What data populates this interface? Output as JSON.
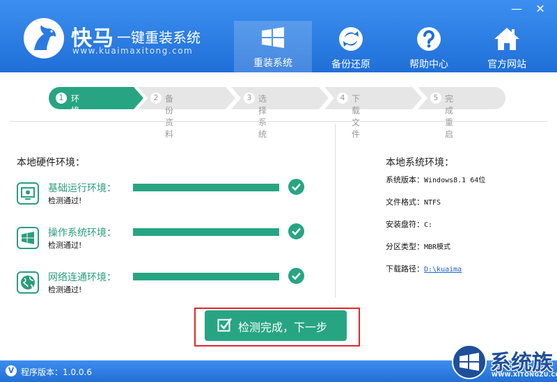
{
  "window": {
    "minimize_glyph": "—",
    "close_glyph": "✕"
  },
  "brand": {
    "name": "快马",
    "subtitle": "一键重装系统",
    "url": "www.kuaimaxitong.com"
  },
  "nav": [
    {
      "label": "重装系统",
      "icon": "windows-icon",
      "active": true
    },
    {
      "label": "备份还原",
      "icon": "sync-icon",
      "active": false
    },
    {
      "label": "帮助中心",
      "icon": "help-icon",
      "active": false
    },
    {
      "label": "官方网站",
      "icon": "home-icon",
      "active": false
    }
  ],
  "steps": [
    {
      "num": "1",
      "label": "环境检测",
      "active": true
    },
    {
      "num": "2",
      "label": "备份资料",
      "active": false
    },
    {
      "num": "3",
      "label": "选择系统",
      "active": false
    },
    {
      "num": "4",
      "label": "下载文件",
      "active": false
    },
    {
      "num": "5",
      "label": "完成重启",
      "active": false
    }
  ],
  "hardware": {
    "title": "本地硬件环境：",
    "rows": [
      {
        "label": "基础运行环境：",
        "status": "检测通过!",
        "icon": "monitor-icon",
        "progress": 1.0
      },
      {
        "label": "操作系统环境：",
        "status": "检测通过!",
        "icon": "windows-icon",
        "progress": 1.0
      },
      {
        "label": "网络连通环境：",
        "status": "检测通过!",
        "icon": "globe-icon",
        "progress": 1.0
      }
    ]
  },
  "system": {
    "title": "本地系统环境：",
    "version_label": "系统版本：",
    "version_value": "Windows8.1  64位",
    "fs_label": "文件格式：",
    "fs_value": "NTFS",
    "drive_label": "安装盘符：",
    "drive_value": "C:",
    "partition_label": "分区类型：",
    "partition_value": "MBR模式",
    "download_label": "下载路径：",
    "download_value": "D:\\kuaima"
  },
  "next_button": {
    "label": "检测完成，下一步"
  },
  "footer": {
    "badge": "V",
    "version_text": "程序版本：1.0.0.6"
  },
  "watermark": {
    "text": "系统族",
    "url": "WWW.XITONGZU.COM"
  },
  "colors": {
    "header": "#2a7ae2",
    "accent": "#27a583",
    "inactive_step": "#e6e6e6",
    "highlight": "#e0262c"
  }
}
